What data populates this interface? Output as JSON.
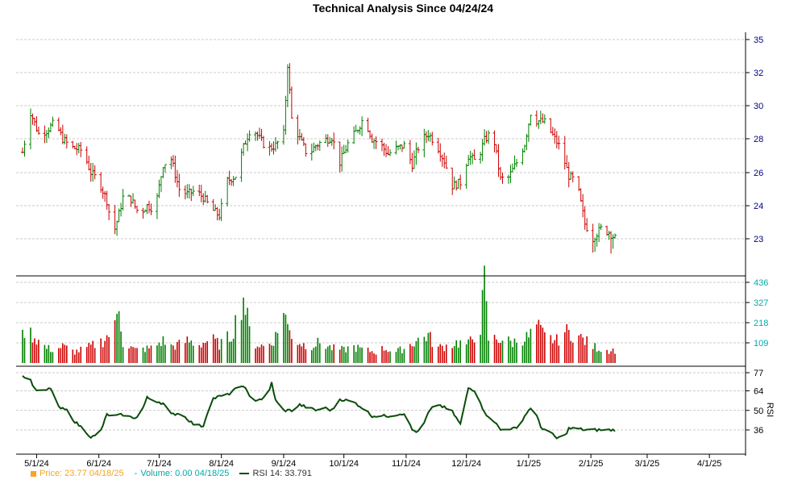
{
  "chart_data": {
    "type": "ohlc",
    "title": "Technical Analysis Since 04/24/24",
    "colors": {
      "up": "#008000",
      "down": "#cc0000",
      "grid": "#bbbbbb",
      "axis": "#000000",
      "price_axis_text": "#000080",
      "volume_axis_text": "#00aaaa",
      "rsi_line": "#0a4d0a",
      "price_legend": "#f5a623",
      "volume_legend": "#00aaaa",
      "rsi_legend": "#0a4d0a"
    },
    "price_panel": {
      "ylim": [
        21.5,
        35.5
      ],
      "yticks": [
        "35",
        "32",
        "30",
        "28",
        "26",
        "24",
        "23"
      ],
      "ytick_values": [
        35,
        33,
        31,
        29,
        27,
        25,
        23
      ]
    },
    "volume_panel": {
      "ylim": [
        0,
        436
      ],
      "yticks": [
        "436",
        "327",
        "218",
        "109"
      ],
      "ytick_values": [
        436,
        327,
        218,
        109
      ]
    },
    "rsi_panel": {
      "ylim": [
        28,
        77
      ],
      "yticks": [
        "77",
        "64",
        "50",
        "36"
      ],
      "ytick_values": [
        77,
        64,
        50,
        36
      ],
      "ylabel": "RSI"
    },
    "x_labels": [
      "5/1/24",
      "6/1/24",
      "7/1/24",
      "8/1/24",
      "9/1/24",
      "10/1/24",
      "11/1/24",
      "12/1/24",
      "1/1/25",
      "2/1/25",
      "3/1/25",
      "4/1/25"
    ],
    "x_label_days": [
      7,
      38,
      68,
      99,
      130,
      160,
      191,
      221,
      252,
      283,
      311,
      342
    ],
    "x_range_days": [
      0,
      360
    ],
    "price_anchors": [
      [
        0,
        28.2
      ],
      [
        4,
        30.6
      ],
      [
        8,
        29.3
      ],
      [
        12,
        29.5
      ],
      [
        16,
        30.0
      ],
      [
        20,
        29.0
      ],
      [
        24,
        28.5
      ],
      [
        30,
        28.3
      ],
      [
        34,
        27.0
      ],
      [
        38,
        26.5
      ],
      [
        42,
        25.3
      ],
      [
        44,
        24.0
      ],
      [
        46,
        23.6
      ],
      [
        48,
        24.5
      ],
      [
        50,
        25.5
      ],
      [
        54,
        25.4
      ],
      [
        58,
        24.5
      ],
      [
        62,
        25.0
      ],
      [
        66,
        24.8
      ],
      [
        70,
        27.5
      ],
      [
        74,
        27.8
      ],
      [
        78,
        26.0
      ],
      [
        82,
        25.7
      ],
      [
        86,
        25.9
      ],
      [
        90,
        25.5
      ],
      [
        94,
        24.8
      ],
      [
        98,
        24.4
      ],
      [
        102,
        26.5
      ],
      [
        106,
        26.8
      ],
      [
        110,
        28.5
      ],
      [
        114,
        29.8
      ],
      [
        118,
        29.0
      ],
      [
        122,
        28.4
      ],
      [
        126,
        28.6
      ],
      [
        130,
        29.3
      ],
      [
        132,
        33.5
      ],
      [
        134,
        30.2
      ],
      [
        138,
        29.0
      ],
      [
        142,
        28.0
      ],
      [
        146,
        28.6
      ],
      [
        150,
        28.9
      ],
      [
        154,
        29.1
      ],
      [
        158,
        27.6
      ],
      [
        162,
        28.7
      ],
      [
        166,
        29.4
      ],
      [
        170,
        30.3
      ],
      [
        174,
        29.0
      ],
      [
        178,
        28.7
      ],
      [
        182,
        28.1
      ],
      [
        186,
        28.4
      ],
      [
        190,
        28.6
      ],
      [
        194,
        27.5
      ],
      [
        198,
        28.8
      ],
      [
        202,
        29.3
      ],
      [
        204,
        29.0
      ],
      [
        206,
        28.7
      ],
      [
        210,
        27.7
      ],
      [
        214,
        26.2
      ],
      [
        218,
        26.4
      ],
      [
        222,
        28.0
      ],
      [
        226,
        27.6
      ],
      [
        230,
        28.9
      ],
      [
        234,
        29.5
      ],
      [
        238,
        26.6
      ],
      [
        242,
        26.7
      ],
      [
        246,
        27.6
      ],
      [
        250,
        28.7
      ],
      [
        254,
        31.2
      ],
      [
        256,
        30.1
      ],
      [
        260,
        30.0
      ],
      [
        264,
        29.2
      ],
      [
        268,
        28.4
      ],
      [
        272,
        26.8
      ],
      [
        276,
        26.4
      ],
      [
        280,
        23.9
      ],
      [
        284,
        23.1
      ],
      [
        288,
        23.6
      ],
      [
        292,
        23.4
      ],
      [
        296,
        22.9
      ]
    ],
    "volume_anchors": [
      [
        0,
        140
      ],
      [
        2,
        220
      ],
      [
        4,
        160
      ],
      [
        8,
        120
      ],
      [
        12,
        80
      ],
      [
        16,
        70
      ],
      [
        20,
        90
      ],
      [
        26,
        60
      ],
      [
        32,
        80
      ],
      [
        40,
        120
      ],
      [
        46,
        190
      ],
      [
        48,
        320
      ],
      [
        50,
        110
      ],
      [
        56,
        70
      ],
      [
        64,
        80
      ],
      [
        70,
        120
      ],
      [
        74,
        90
      ],
      [
        78,
        100
      ],
      [
        82,
        120
      ],
      [
        88,
        100
      ],
      [
        94,
        130
      ],
      [
        98,
        100
      ],
      [
        104,
        150
      ],
      [
        110,
        360
      ],
      [
        114,
        110
      ],
      [
        120,
        90
      ],
      [
        124,
        110
      ],
      [
        128,
        180
      ],
      [
        130,
        320
      ],
      [
        132,
        190
      ],
      [
        136,
        120
      ],
      [
        142,
        90
      ],
      [
        148,
        110
      ],
      [
        154,
        80
      ],
      [
        160,
        70
      ],
      [
        164,
        90
      ],
      [
        170,
        70
      ],
      [
        176,
        60
      ],
      [
        180,
        80
      ],
      [
        186,
        60
      ],
      [
        190,
        80
      ],
      [
        196,
        120
      ],
      [
        202,
        150
      ],
      [
        206,
        80
      ],
      [
        210,
        90
      ],
      [
        216,
        110
      ],
      [
        222,
        100
      ],
      [
        228,
        200
      ],
      [
        230,
        430
      ],
      [
        232,
        130
      ],
      [
        238,
        130
      ],
      [
        244,
        110
      ],
      [
        248,
        130
      ],
      [
        252,
        140
      ],
      [
        256,
        200
      ],
      [
        260,
        140
      ],
      [
        266,
        120
      ],
      [
        270,
        170
      ],
      [
        276,
        150
      ],
      [
        280,
        120
      ],
      [
        284,
        90
      ],
      [
        290,
        70
      ]
    ],
    "rsi_anchors": [
      [
        0,
        74
      ],
      [
        3,
        75
      ],
      [
        6,
        65
      ],
      [
        10,
        63
      ],
      [
        14,
        66
      ],
      [
        18,
        52
      ],
      [
        22,
        50
      ],
      [
        26,
        42
      ],
      [
        30,
        37
      ],
      [
        34,
        31
      ],
      [
        38,
        32
      ],
      [
        42,
        47
      ],
      [
        46,
        46
      ],
      [
        50,
        47
      ],
      [
        54,
        45
      ],
      [
        58,
        45
      ],
      [
        62,
        59
      ],
      [
        66,
        57
      ],
      [
        70,
        55
      ],
      [
        74,
        47
      ],
      [
        78,
        48
      ],
      [
        82,
        44
      ],
      [
        86,
        39
      ],
      [
        90,
        39
      ],
      [
        94,
        58
      ],
      [
        98,
        60
      ],
      [
        102,
        61
      ],
      [
        106,
        65
      ],
      [
        110,
        68
      ],
      [
        114,
        57
      ],
      [
        118,
        58
      ],
      [
        122,
        59
      ],
      [
        124,
        70
      ],
      [
        126,
        57
      ],
      [
        130,
        50
      ],
      [
        134,
        50
      ],
      [
        138,
        54
      ],
      [
        142,
        52
      ],
      [
        146,
        50
      ],
      [
        150,
        52
      ],
      [
        154,
        50
      ],
      [
        158,
        58
      ],
      [
        162,
        57
      ],
      [
        166,
        55
      ],
      [
        170,
        51
      ],
      [
        174,
        46
      ],
      [
        178,
        46
      ],
      [
        182,
        46
      ],
      [
        186,
        47
      ],
      [
        190,
        48
      ],
      [
        194,
        36
      ],
      [
        198,
        34
      ],
      [
        202,
        48
      ],
      [
        206,
        55
      ],
      [
        210,
        52
      ],
      [
        214,
        49
      ],
      [
        218,
        40
      ],
      [
        222,
        66
      ],
      [
        226,
        64
      ],
      [
        230,
        48
      ],
      [
        234,
        44
      ],
      [
        238,
        36
      ],
      [
        242,
        37
      ],
      [
        246,
        37
      ],
      [
        250,
        46
      ],
      [
        254,
        54
      ],
      [
        258,
        38
      ],
      [
        262,
        35
      ],
      [
        266,
        30
      ],
      [
        270,
        32
      ],
      [
        272,
        37
      ],
      [
        276,
        37
      ],
      [
        280,
        36
      ]
    ],
    "legend": [
      {
        "label": "Price: 23.77  04/18/25",
        "marker": "square"
      },
      {
        "label": "Volume: 0.00  04/18/25",
        "marker": "dash"
      },
      {
        "label": "RSI 14: 33.791",
        "marker": "line"
      }
    ]
  }
}
